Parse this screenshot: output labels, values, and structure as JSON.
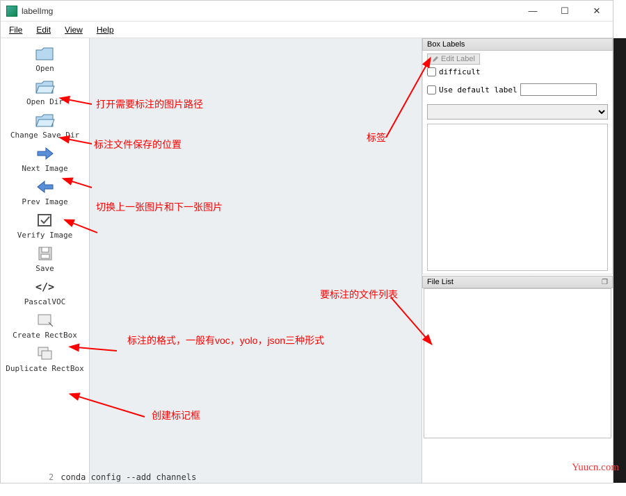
{
  "window": {
    "title": "labelImg",
    "minimize": "—",
    "maximize": "☐",
    "close": "✕"
  },
  "menu": {
    "file": "File",
    "edit": "Edit",
    "view": "View",
    "help": "Help"
  },
  "toolbar": {
    "open": "Open",
    "open_dir": "Open Dir",
    "change_save_dir": "Change Save Dir",
    "next_image": "Next Image",
    "prev_image": "Prev Image",
    "verify_image": "Verify Image",
    "save": "Save",
    "format": "PascalVOC",
    "format_code": "</>",
    "create_rectbox": "Create RectBox",
    "duplicate_rectbox": "Duplicate RectBox"
  },
  "right": {
    "box_labels_header": "Box Labels",
    "edit_label": "Edit Label",
    "difficult": "difficult",
    "use_default_label": "Use default label",
    "file_list_header": "File List"
  },
  "annotations": {
    "open_dir_hint": "打开需要标注的图片路径",
    "save_dir_hint": "标注文件保存的位置",
    "nav_hint": "切换上一张图片和下一张图片",
    "format_hint": "标注的格式，一般有voc，yolo，json三种形式",
    "create_hint": "创建标记框",
    "label_hint": "标签",
    "filelist_hint": "要标注的文件列表"
  },
  "watermark": "Yuucn.com",
  "terminal": {
    "lineno": "2",
    "cmd": "conda config --add channels"
  }
}
